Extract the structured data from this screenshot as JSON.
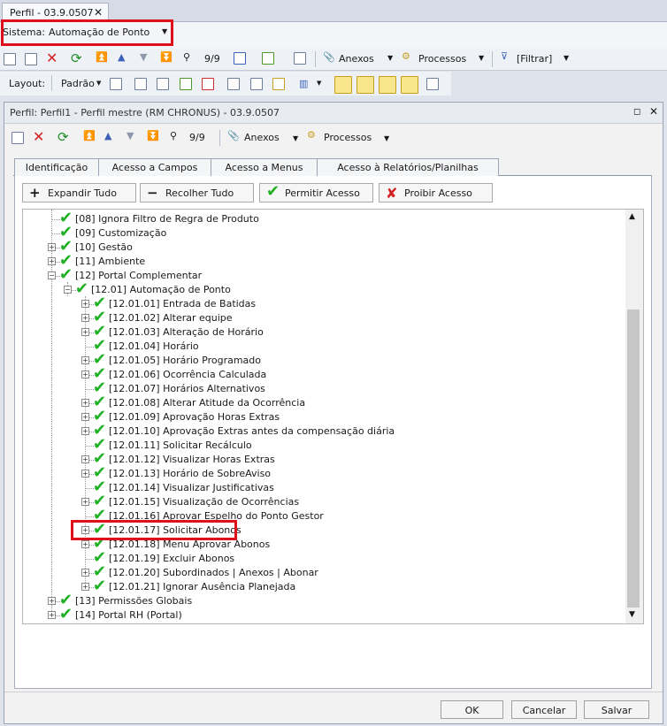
{
  "doc_tab": {
    "title": "Perfil - 03.9.0507",
    "close": "✕"
  },
  "sistema": {
    "label": "Sistema:",
    "value": "Automação de Ponto"
  },
  "main_toolbar": {
    "record_counter": "9/9",
    "anexos": "Anexos",
    "processos": "Processos",
    "filtrar": "[Filtrar]"
  },
  "layout_toolbar": {
    "label": "Layout:",
    "value": "Padrão"
  },
  "inner_window": {
    "title": "Perfil: Perfil1 - Perfil mestre (RM CHRONUS) - 03.9.0507"
  },
  "inner_toolbar": {
    "record_counter": "9/9",
    "anexos": "Anexos",
    "processos": "Processos"
  },
  "tabs": [
    {
      "label": "Identificação",
      "active": false
    },
    {
      "label": "Acesso a Campos",
      "active": false
    },
    {
      "label": "Acesso a Menus",
      "active": true
    },
    {
      "label": "Acesso à Relatórios/Planilhas",
      "active": false
    }
  ],
  "actions": {
    "expand": "Expandir Tudo",
    "collapse": "Recolher Tudo",
    "allow": "Permitir Acesso",
    "deny": "Proibir Acesso"
  },
  "tree": [
    {
      "label": "[08] Ignora Filtro de Regra de Produto",
      "level": 1,
      "expander": "none"
    },
    {
      "label": "[09] Customização",
      "level": 1,
      "expander": "none"
    },
    {
      "label": "[10] Gestão",
      "level": 1,
      "expander": "plus"
    },
    {
      "label": "[11] Ambiente",
      "level": 1,
      "expander": "plus"
    },
    {
      "label": "[12] Portal Complementar",
      "level": 1,
      "expander": "minus"
    },
    {
      "label": "[12.01] Automação de Ponto",
      "level": 2,
      "expander": "minus"
    },
    {
      "label": "[12.01.01] Entrada de Batidas",
      "level": 3,
      "expander": "plus"
    },
    {
      "label": "[12.01.02] Alterar equipe",
      "level": 3,
      "expander": "plus"
    },
    {
      "label": "[12.01.03] Alteração de Horário",
      "level": 3,
      "expander": "plus"
    },
    {
      "label": "[12.01.04] Horário",
      "level": 3,
      "expander": "none"
    },
    {
      "label": "[12.01.05] Horário Programado",
      "level": 3,
      "expander": "plus"
    },
    {
      "label": "[12.01.06] Ocorrência Calculada",
      "level": 3,
      "expander": "plus"
    },
    {
      "label": "[12.01.07] Horários Alternativos",
      "level": 3,
      "expander": "none"
    },
    {
      "label": "[12.01.08] Alterar Atitude da Ocorrência",
      "level": 3,
      "expander": "plus"
    },
    {
      "label": "[12.01.09] Aprovação Horas Extras",
      "level": 3,
      "expander": "plus"
    },
    {
      "label": "[12.01.10] Aprovação Extras antes da compensação diária",
      "level": 3,
      "expander": "plus"
    },
    {
      "label": "[12.01.11] Solicitar Recálculo",
      "level": 3,
      "expander": "none"
    },
    {
      "label": "[12.01.12] Visualizar Horas Extras",
      "level": 3,
      "expander": "plus"
    },
    {
      "label": "[12.01.13] Horário de SobreAviso",
      "level": 3,
      "expander": "plus"
    },
    {
      "label": "[12.01.14] Visualizar Justificativas",
      "level": 3,
      "expander": "none"
    },
    {
      "label": "[12.01.15] Visualização de Ocorrências",
      "level": 3,
      "expander": "plus"
    },
    {
      "label": "[12.01.16] Aprovar Espelho do Ponto Gestor",
      "level": 3,
      "expander": "none"
    },
    {
      "label": "[12.01.17] Solicitar Abonos",
      "level": 3,
      "expander": "plus"
    },
    {
      "label": "[12.01.18] Menu Aprovar Abonos",
      "level": 3,
      "expander": "plus"
    },
    {
      "label": "[12.01.19] Excluir Abonos",
      "level": 3,
      "expander": "none"
    },
    {
      "label": "[12.01.20] Subordinados | Anexos | Abonar",
      "level": 3,
      "expander": "plus"
    },
    {
      "label": "[12.01.21] Ignorar Ausência Planejada",
      "level": 3,
      "expander": "plus"
    },
    {
      "label": "[13] Permissões Globais",
      "level": 1,
      "expander": "plus"
    },
    {
      "label": "[14] Portal RH (Portal)",
      "level": 1,
      "expander": "plus"
    }
  ],
  "dialog_buttons": {
    "ok": "OK",
    "cancel": "Cancelar",
    "save": "Salvar"
  },
  "colors": {
    "check": "#22b024",
    "highlight": "#e0101a",
    "deny": "#d42020"
  }
}
